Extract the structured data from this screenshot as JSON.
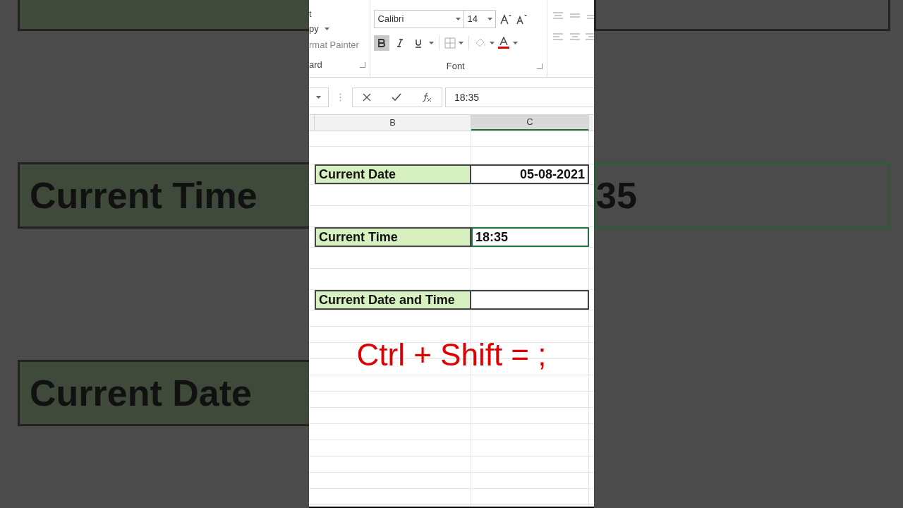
{
  "backdrop": {
    "left_labels": [
      "Current Time",
      "Current Date"
    ],
    "right_values": [
      "35"
    ]
  },
  "ribbon": {
    "clipboard_items": [
      "t",
      "py",
      "rmat Painter"
    ],
    "clipboard_group": "ard",
    "font_name": "Calibri",
    "font_size": "14",
    "bold": true,
    "italic": false,
    "underline": false,
    "font_group": "Font"
  },
  "formula_bar": {
    "value": "18:35"
  },
  "columns": [
    {
      "label": "B",
      "selected": false
    },
    {
      "label": "C",
      "selected": true
    }
  ],
  "rows": [
    {
      "label": "Current Date",
      "value": "05-08-2021",
      "kind": "date",
      "selected": false
    },
    {
      "label": "Current Time",
      "value": "18:35",
      "kind": "text",
      "selected": true
    },
    {
      "label": "Current Date and Time",
      "kind": "text",
      "selected": false
    }
  ],
  "overlay_text": "Ctrl + Shift = ;"
}
